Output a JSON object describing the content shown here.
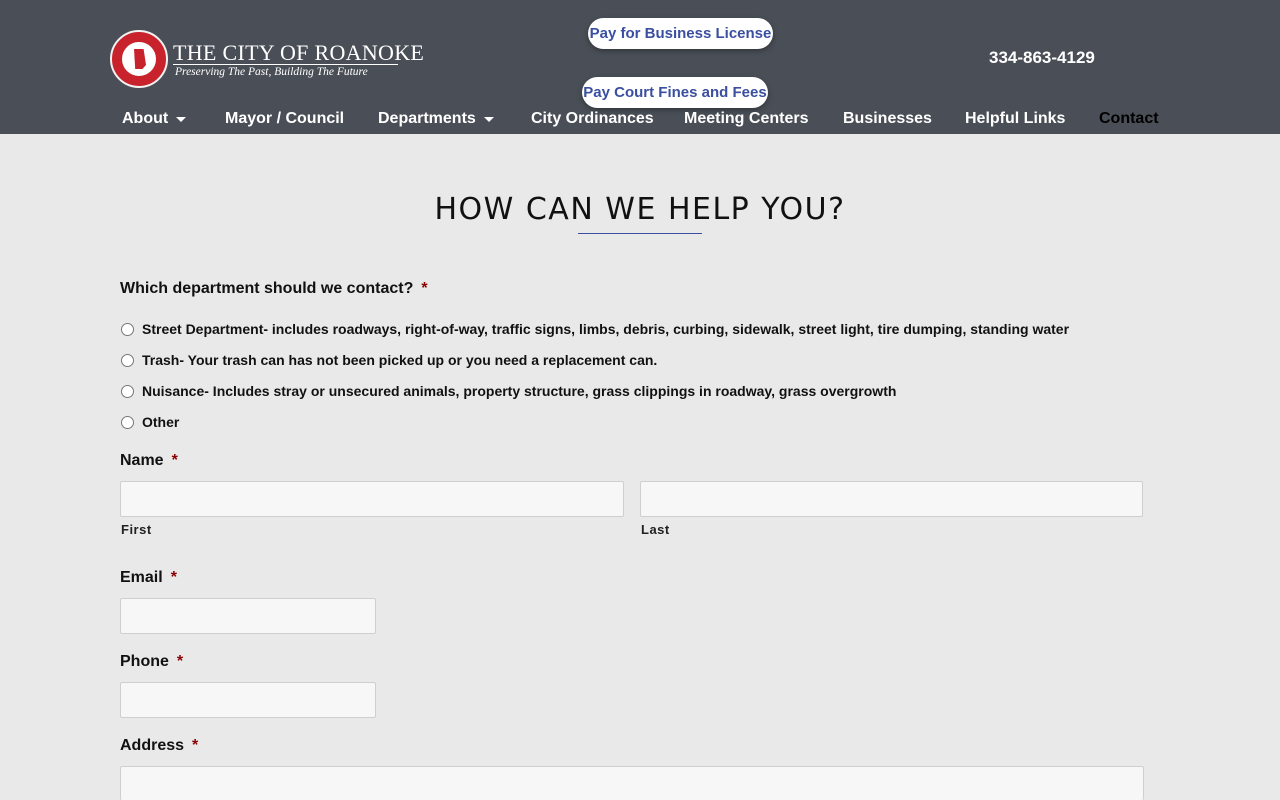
{
  "header": {
    "logo": {
      "title": "THE CITY OF ROANOKE",
      "tagline": "Preserving The Past, Building The Future"
    },
    "buttons": {
      "business_license": "Pay for Business License",
      "court_fines": "Pay Court Fines and Fees"
    },
    "phone": "334-863-4129",
    "nav": [
      {
        "label": "About",
        "has_dropdown": true
      },
      {
        "label": "Mayor / Council",
        "has_dropdown": false
      },
      {
        "label": "Departments",
        "has_dropdown": true
      },
      {
        "label": "City Ordinances",
        "has_dropdown": false
      },
      {
        "label": "Meeting Centers",
        "has_dropdown": false
      },
      {
        "label": "Businesses",
        "has_dropdown": false
      },
      {
        "label": "Helpful Links",
        "has_dropdown": false
      },
      {
        "label": "Contact",
        "has_dropdown": false,
        "active": true
      }
    ]
  },
  "main": {
    "heading": "HOW CAN WE HELP YOU?",
    "form": {
      "required_marker": "*",
      "department": {
        "label": "Which department should we contact?",
        "options": [
          "Street Department- includes roadways, right-of-way, traffic signs, limbs, debris, curbing, sidewalk, street light, tire dumping, standing water",
          "Trash- Your trash can has not been picked up or you need a replacement can.",
          "Nuisance- Includes stray or unsecured animals, property structure, grass clippings in roadway, grass overgrowth",
          "Other"
        ]
      },
      "name": {
        "label": "Name",
        "first_label": "First",
        "last_label": "Last",
        "first_value": "",
        "last_value": ""
      },
      "email": {
        "label": "Email",
        "value": ""
      },
      "phone": {
        "label": "Phone",
        "value": ""
      },
      "address": {
        "label": "Address",
        "value": ""
      }
    }
  },
  "colors": {
    "header_bg": "#4a4f57",
    "page_bg": "#e9e9e9",
    "accent": "#3b4fa0",
    "required": "#8b0000"
  }
}
